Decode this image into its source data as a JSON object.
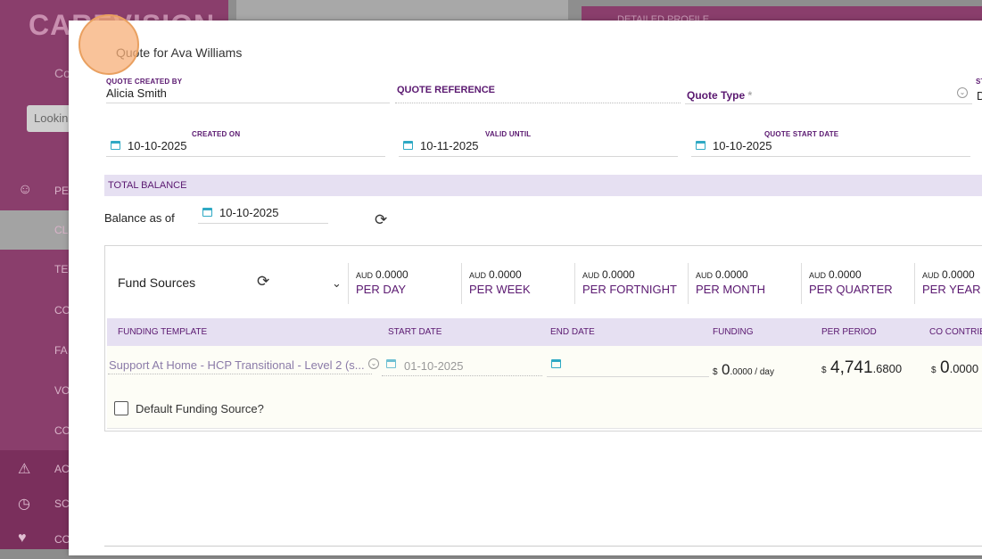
{
  "background": {
    "logo": "CAREVISION",
    "sub_label": "Co",
    "search_placeholder": "Lookin",
    "menu": [
      "PE",
      "CL",
      "TE",
      "CO",
      "FA",
      "VO",
      "CO",
      "AC",
      "SC",
      "CO"
    ],
    "right_header": "DETAILED PROFILE"
  },
  "modal": {
    "title": "Quote for Ava Williams",
    "quote_created_by_label": "QUOTE CREATED BY",
    "quote_created_by": "Alicia Smith",
    "quote_reference_label": "QUOTE REFERENCE",
    "quote_type_label": "Quote Type",
    "required_mark": "*",
    "status_label": "ST",
    "status_value": "D",
    "created_on_label": "CREATED ON",
    "created_on": "10-10-2025",
    "valid_until_label": "VALID UNTIL",
    "valid_until": "10-11-2025",
    "quote_start_label": "QUOTE START DATE",
    "quote_start": "10-10-2025",
    "total_balance_label": "TOTAL BALANCE",
    "balance_as_of_label": "Balance as of",
    "balance_as_of": "10-10-2025"
  },
  "fund_sources": {
    "title": "Fund Sources",
    "currency": "AUD",
    "metrics": [
      {
        "amount": "0.0000",
        "period": "PER DAY"
      },
      {
        "amount": "0.0000",
        "period": "PER WEEK"
      },
      {
        "amount": "0.0000",
        "period": "PER FORTNIGHT"
      },
      {
        "amount": "0.0000",
        "period": "PER MONTH"
      },
      {
        "amount": "0.0000",
        "period": "PER QUARTER"
      },
      {
        "amount": "0.0000",
        "period": "PER YEAR"
      }
    ],
    "columns": [
      "FUNDING TEMPLATE",
      "START DATE",
      "END DATE",
      "FUNDING",
      "PER PERIOD",
      "CO CONTRIB"
    ],
    "row": {
      "template": "Support At Home - HCP Transitional - Level 2 (s...",
      "start_date": "01-10-2025",
      "end_date": "",
      "funding_symbol": "$",
      "funding_int": "0",
      "funding_dec": ".0000 / day",
      "period_symbol": "$",
      "period_int": "4,741",
      "period_dec": ".6800",
      "co_symbol": "$",
      "co_int": "0",
      "co_dec": ".0000"
    },
    "default_label": "Default Funding Source?"
  },
  "icons": {
    "calendar": "calendar-icon",
    "refresh": "refresh-icon",
    "chevron": "chevron-down-icon",
    "people": "people-icon",
    "warning": "warning-icon"
  }
}
